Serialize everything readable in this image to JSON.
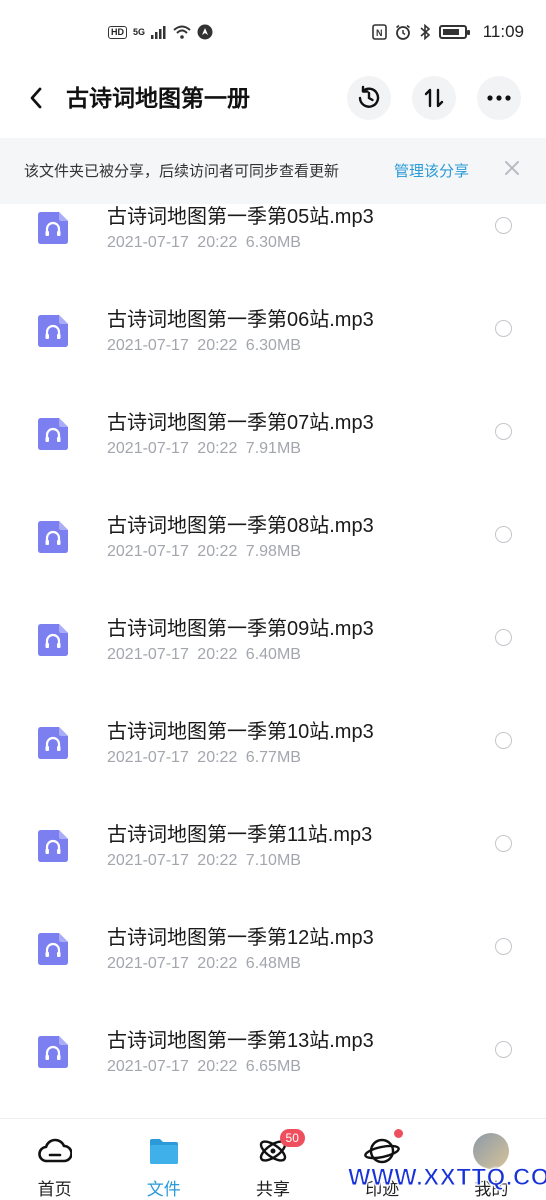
{
  "status_bar": {
    "left_labels": [
      "HD",
      "5G"
    ],
    "time": "11:09"
  },
  "header": {
    "title": "古诗词地图第一册",
    "back_icon": "chevron-left-icon",
    "actions": [
      "history-icon",
      "sort-icon",
      "more-icon"
    ]
  },
  "banner": {
    "text": "该文件夹已被分享，后续访问者可同步查看更新",
    "link": "管理该分享",
    "close_icon": "close-icon"
  },
  "files": [
    {
      "name": "古诗词地图第一季第05站.mp3",
      "date": "2021-07-17",
      "time": "20:22",
      "size": "6.30MB"
    },
    {
      "name": "古诗词地图第一季第06站.mp3",
      "date": "2021-07-17",
      "time": "20:22",
      "size": "6.30MB"
    },
    {
      "name": "古诗词地图第一季第07站.mp3",
      "date": "2021-07-17",
      "time": "20:22",
      "size": "7.91MB"
    },
    {
      "name": "古诗词地图第一季第08站.mp3",
      "date": "2021-07-17",
      "time": "20:22",
      "size": "7.98MB"
    },
    {
      "name": "古诗词地图第一季第09站.mp3",
      "date": "2021-07-17",
      "time": "20:22",
      "size": "6.40MB"
    },
    {
      "name": "古诗词地图第一季第10站.mp3",
      "date": "2021-07-17",
      "time": "20:22",
      "size": "6.77MB"
    },
    {
      "name": "古诗词地图第一季第11站.mp3",
      "date": "2021-07-17",
      "time": "20:22",
      "size": "7.10MB"
    },
    {
      "name": "古诗词地图第一季第12站.mp3",
      "date": "2021-07-17",
      "time": "20:22",
      "size": "6.48MB"
    },
    {
      "name": "古诗词地图第一季第13站.mp3",
      "date": "2021-07-17",
      "time": "20:22",
      "size": "6.65MB"
    }
  ],
  "bottom_nav": {
    "items": [
      {
        "label": "首页",
        "icon": "cloud-icon",
        "active": false
      },
      {
        "label": "文件",
        "icon": "folder-icon",
        "active": true
      },
      {
        "label": "共享",
        "icon": "atom-icon",
        "active": false,
        "badge": "50"
      },
      {
        "label": "印迹",
        "icon": "planet-icon",
        "active": false,
        "dot": true
      },
      {
        "label": "我的",
        "icon": "avatar",
        "active": false
      }
    ]
  },
  "watermark": "WWW.XXTTQ.COM",
  "colors": {
    "accent": "#2a9bd8",
    "file_icon": "#7b7ff0",
    "badge": "#ef4e5c",
    "meta_text": "#a3a6ad"
  }
}
